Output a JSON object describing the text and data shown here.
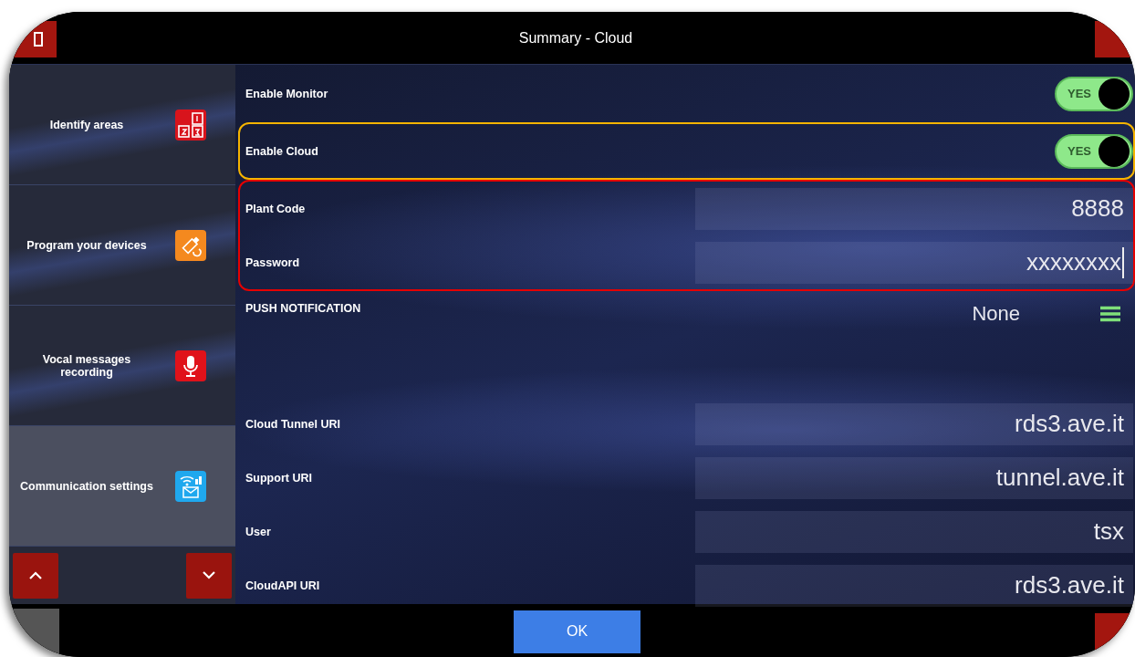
{
  "window": {
    "title": "Summary - Cloud"
  },
  "sidebar": {
    "items": [
      {
        "label": "Identify areas",
        "selected": false
      },
      {
        "label": "Program your devices",
        "selected": false
      },
      {
        "label": "Vocal messages recording",
        "selected": false
      },
      {
        "label": "Communication settings",
        "selected": true
      }
    ]
  },
  "groups": [
    {
      "rows": [
        {
          "kind": "toggle",
          "label": "Enable Monitor",
          "on": true,
          "value": "YES"
        }
      ]
    },
    {
      "color": "#f5b400",
      "rows": [
        {
          "kind": "toggle",
          "label": "Enable Cloud",
          "on": true,
          "value": "YES"
        }
      ]
    },
    {
      "color": "#e60000",
      "rows": [
        {
          "kind": "field",
          "label": "Plant Code",
          "value": "8888",
          "focused": false
        },
        {
          "kind": "field",
          "label": "Password",
          "value": "xxxxxxxx",
          "focused": true
        }
      ]
    },
    {
      "rows": [
        {
          "kind": "select",
          "label": "PUSH NOTIFICATION",
          "value": "None"
        },
        {
          "kind": "field",
          "label": "Cloud Tunnel URI",
          "value": "rds3.ave.it",
          "focused": false
        },
        {
          "kind": "field",
          "label": "Support URI",
          "value": "tunnel.ave.it",
          "focused": false
        },
        {
          "kind": "field",
          "label": "User",
          "value": "tsx",
          "focused": false
        },
        {
          "kind": "field",
          "label": "CloudAPI URI",
          "value": "rds3.ave.it",
          "focused": false
        }
      ]
    }
  ],
  "footer": {
    "button": "OK"
  }
}
